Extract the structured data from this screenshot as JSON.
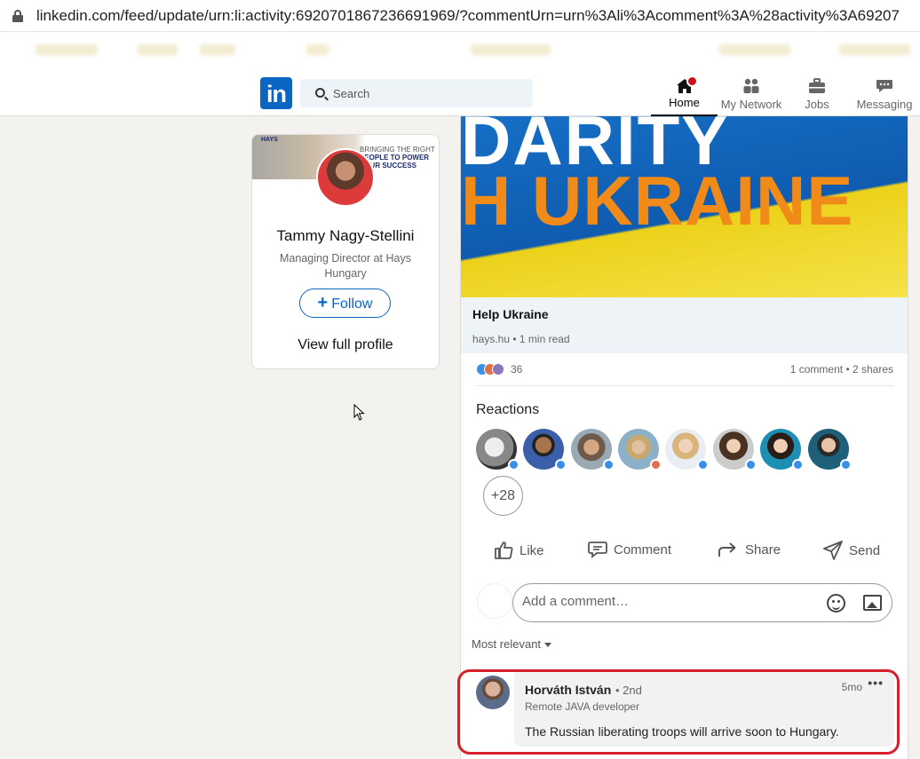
{
  "browser": {
    "url": "linkedin.com/feed/update/urn:li:activity:6920701867236691969/?commentUrn=urn%3Ali%3Acomment%3A%28activity%3A69207"
  },
  "nav": {
    "logo": "in",
    "search_placeholder": "Search",
    "items": [
      {
        "label": "Home",
        "icon": "home-icon"
      },
      {
        "label": "My Network",
        "icon": "network-icon"
      },
      {
        "label": "Jobs",
        "icon": "briefcase-icon"
      },
      {
        "label": "Messaging",
        "icon": "messaging-icon"
      }
    ]
  },
  "profile": {
    "banner_brand": "HAYS",
    "banner_line1": "BRINGING THE RIGHT",
    "banner_line2": "PEOPLE TO POWER",
    "banner_line3": "YOUR SUCCESS",
    "name": "Tammy Nagy-Stellini",
    "headline": "Managing Director at Hays Hungary",
    "follow_label": "Follow",
    "view_profile_label": "View full profile"
  },
  "post": {
    "hero_line1": "DARITY",
    "hero_line2": "H UKRAINE",
    "link_title": "Help Ukraine",
    "link_source": "hays.hu • 1 min read",
    "reaction_count": "36",
    "comments_shares": "1 comment • 2 shares",
    "reactions_title": "Reactions",
    "more_reactors": "+28",
    "actions": {
      "like": "Like",
      "comment": "Comment",
      "share": "Share",
      "send": "Send"
    },
    "comment_placeholder": "Add a comment…",
    "sort_label": "Most relevant"
  },
  "comment": {
    "author": "Horváth István",
    "degree": "• 2nd",
    "headline": "Remote JAVA developer",
    "time": "5mo",
    "more": "•••",
    "text": "The Russian liberating troops will arrive soon to Hungary."
  },
  "colors": {
    "brand": "#0a66c2",
    "highlight": "#d6202b"
  }
}
